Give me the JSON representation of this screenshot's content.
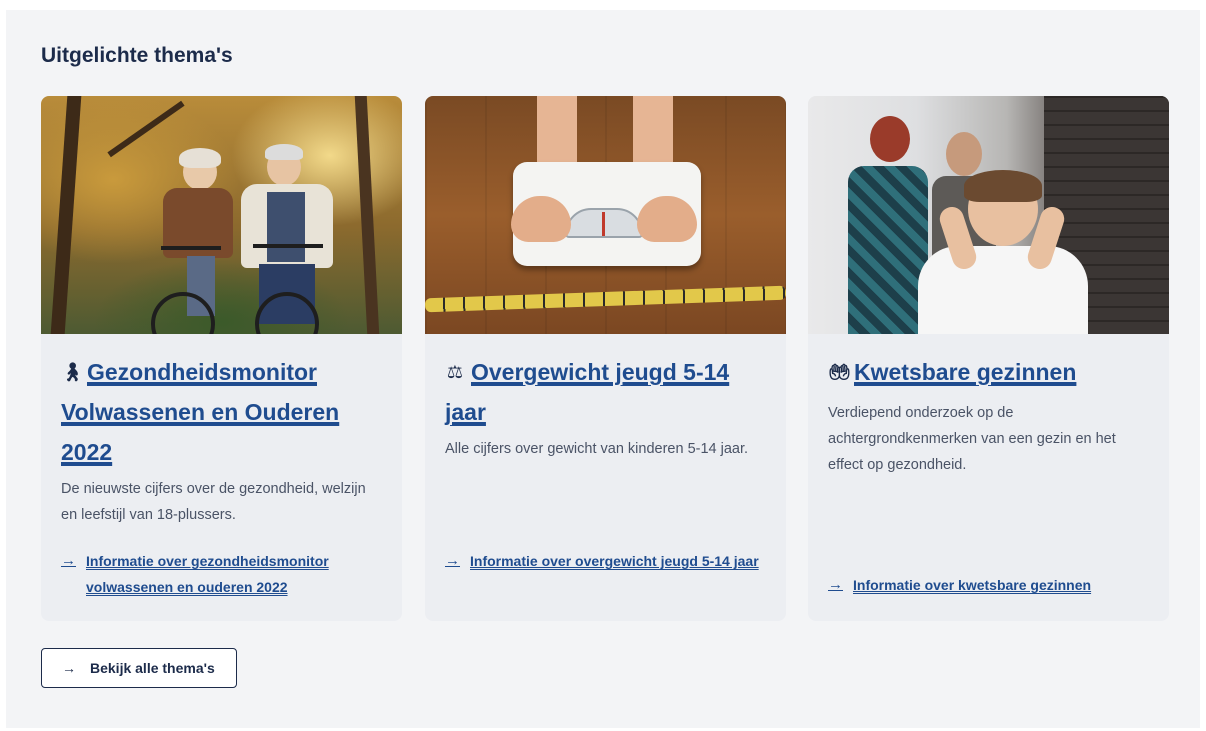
{
  "section": {
    "title": "Uitgelichte thema's"
  },
  "cards": [
    {
      "icon": "person-standing-icon",
      "icon_glyph": "🚶",
      "title": "Gezondheidsmonitor Volwassenen en Ouderen 2022",
      "description": "De nieuwste cijfers over de gezondheid, welzijn en leefstijl van 18-plussers.",
      "link": "Informatie over gezondheidsmonitor volwassenen en ouderen 2022"
    },
    {
      "icon": "weight-scale-icon",
      "icon_glyph": "⚖",
      "title": "Overgewicht jeugd 5-14 jaar",
      "description": "Alle cijfers over gewicht van kinderen 5-14 jaar.",
      "link": "Informatie over overgewicht jeugd 5-14 jaar"
    },
    {
      "icon": "hands-heart-icon",
      "icon_glyph": "🤲",
      "title": "Kwetsbare gezinnen",
      "description": "Verdiepend onderzoek op de achtergrondkenmerken van een gezin en het effect op gezondheid.",
      "link": "Informatie over kwetsbare gezinnen"
    }
  ],
  "button": {
    "label": "Bekijk alle thema's"
  },
  "colors": {
    "link": "#1f4c8f",
    "heading": "#1c2b4a",
    "panel": "#f3f4f6",
    "card": "#eceef2"
  }
}
